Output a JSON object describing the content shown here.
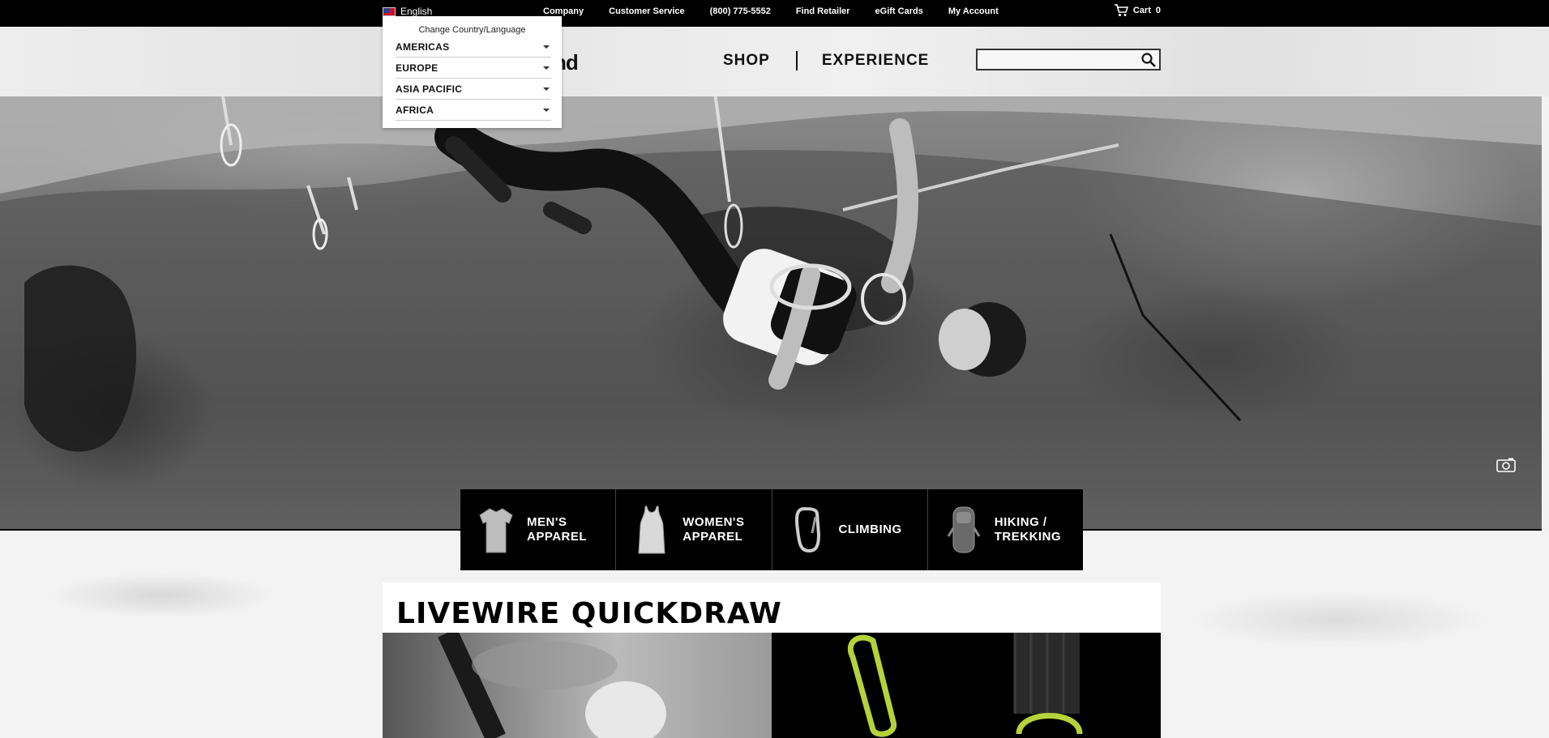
{
  "topbar": {
    "language": "English",
    "links": [
      "Company",
      "Customer Service",
      "(800) 775-5552",
      "Find Retailer",
      "eGift Cards",
      "My Account"
    ],
    "cart_label": "Cart",
    "cart_count": "0"
  },
  "header": {
    "logo_fragment": "nd",
    "nav": [
      "SHOP",
      "EXPERIENCE"
    ],
    "search_placeholder": ""
  },
  "dropdown": {
    "title": "Change Country/Language",
    "regions": [
      "AMERICAS",
      "EUROPE",
      "ASIA PACIFIC",
      "AFRICA"
    ]
  },
  "tiles": [
    {
      "line1": "MEN'S",
      "line2": "APPAREL",
      "icon": "shirt-icon"
    },
    {
      "line1": "WOMEN'S",
      "line2": "APPAREL",
      "icon": "tank-top-icon"
    },
    {
      "line1": "CLIMBING",
      "line2": "",
      "icon": "carabiner-icon"
    },
    {
      "line1": "HIKING /",
      "line2": "TREKKING",
      "icon": "backpack-icon"
    }
  ],
  "promo": {
    "title": "LIVEWIRE QUICKDRAW"
  },
  "colors": {
    "topbar_bg": "#000000",
    "tile_bg": "#000000",
    "text_light": "#ffffff"
  }
}
